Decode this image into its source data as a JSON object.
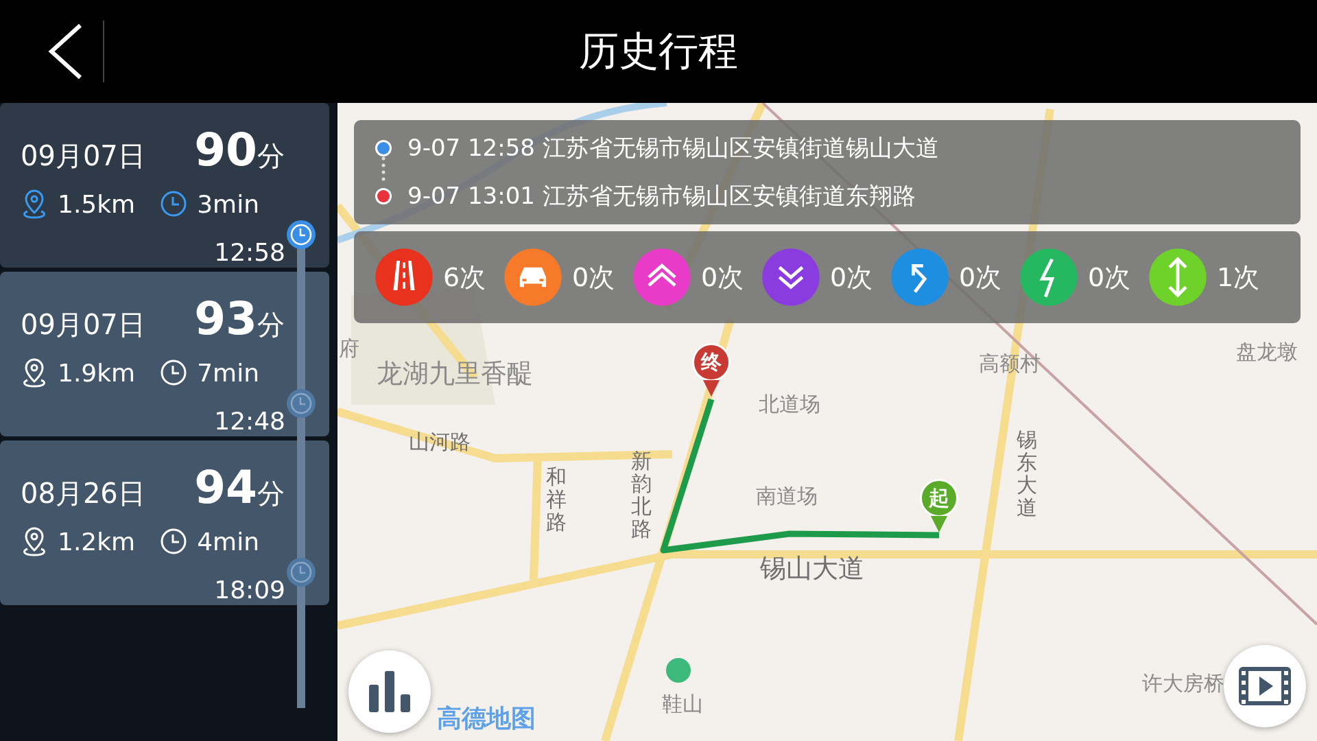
{
  "header": {
    "title": "历史行程"
  },
  "trips": [
    {
      "date": "09月07日",
      "score": "90",
      "unit": "分",
      "distance": "1.5km",
      "duration": "3min",
      "time": "12:58",
      "selected": true
    },
    {
      "date": "09月07日",
      "score": "93",
      "unit": "分",
      "distance": "1.9km",
      "duration": "7min",
      "time": "12:48",
      "selected": false
    },
    {
      "date": "08月26日",
      "score": "94",
      "unit": "分",
      "distance": "1.2km",
      "duration": "4min",
      "time": "18:09",
      "selected": false
    }
  ],
  "route": {
    "points": [
      {
        "kind": "start",
        "color": "#3a8ee6",
        "text": "9-07 12:58 江苏省无锡市锡山区安镇街道锡山大道"
      },
      {
        "kind": "end",
        "color": "#e8323c",
        "text": "9-07 13:01 江苏省无锡市锡山区安镇街道东翔路"
      }
    ]
  },
  "events": [
    {
      "kind": "road",
      "color": "#e8321e",
      "count": "6次"
    },
    {
      "kind": "car",
      "color": "#f77a2a",
      "count": "0次"
    },
    {
      "kind": "up",
      "color": "#e83cc8",
      "count": "0次"
    },
    {
      "kind": "down",
      "color": "#8a3ce0",
      "count": "0次"
    },
    {
      "kind": "turn",
      "color": "#1e8ee0",
      "count": "0次"
    },
    {
      "kind": "bolt",
      "color": "#25b860",
      "count": "0次"
    },
    {
      "kind": "updown",
      "color": "#6ed22a",
      "count": "1次"
    }
  ],
  "map": {
    "labels": [
      {
        "text": "龙湖九里香醍",
        "kind": "area"
      },
      {
        "text": "北道场",
        "kind": "place"
      },
      {
        "text": "高额村",
        "kind": "place"
      },
      {
        "text": "南道场",
        "kind": "place"
      },
      {
        "text": "锡山大道",
        "kind": "road"
      },
      {
        "text": "鞋山",
        "kind": "place"
      },
      {
        "text": "许大房桥",
        "kind": "place"
      },
      {
        "text": "盘龙墩",
        "kind": "place"
      },
      {
        "text": "山河路",
        "kind": "road"
      },
      {
        "text": "和祥路",
        "kind": "vroad"
      },
      {
        "text": "锡东大道",
        "kind": "vroad"
      },
      {
        "text": "新韵北路",
        "kind": "vroad"
      },
      {
        "text": "府",
        "kind": "place"
      }
    ],
    "start_marker": "起",
    "end_marker": "终",
    "logo": "高德地图"
  }
}
